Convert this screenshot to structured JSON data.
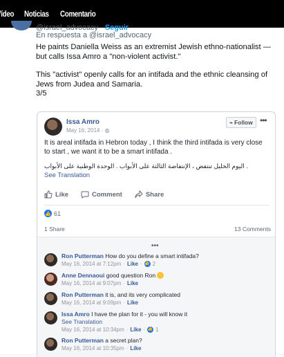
{
  "nav": {
    "items": [
      "Vídeo",
      "Noticias",
      "Comentario"
    ]
  },
  "tweet": {
    "handle_cut": "@israel_advocacy",
    "follow_cut": "Seguir",
    "reply_to": "En respuesta a @israel_advocacy",
    "paragraph1": "He paints Daniella Weiss as an extremist Jewish ethno-nationalist — but calls Issa Amro a \"non-violent activist.\"",
    "paragraph2": "This \"activist\" openly calls for an intifada and the ethnic cleansing of Jews from Judea and Samaria.",
    "counter": "3/5"
  },
  "fb": {
    "author": "Issa Amro",
    "date": "May 16, 2014 · ",
    "follow_label": "Follow",
    "more": "•••",
    "post_text": "It is areal intifada in Hebron today , I think the third intifada is very close to start , we want it to be a smart intifada .",
    "arabic_text": "اليوم الخليل تنتفض ، الإنتفاضة الثالثة على الأبواب . الوحدة الوطنية على الأبواب .",
    "see_translation": "See Translation",
    "actions": {
      "like": "Like",
      "comment": "Comment",
      "share": "Share"
    },
    "likes_count": "61",
    "shares": "1 Share",
    "comments_count": "13 Comments",
    "more_comments": "•••",
    "comments": [
      {
        "name": "Ron Putterman",
        "text": " How do you define a smart intifada?",
        "time": "May 16, 2014 at 7:12pm",
        "like": "Like",
        "likes": "2"
      },
      {
        "name": "Anne Dennaoui",
        "text": " good question Ron ",
        "time": "May 16, 2014 at 9:07pm",
        "like": "Like"
      },
      {
        "name": "Ron Putterman",
        "text": " it is, and its very complicated",
        "time": "May 16, 2014 at 9:09pm",
        "like": "Like"
      },
      {
        "name": "Issa Amro",
        "text": " I have the plan for it - you will know it",
        "see_translation": "See Translation",
        "time": "May 16, 2014 at 10:34pm",
        "like": "Like",
        "likes": "1"
      },
      {
        "name": "Ron Putterman",
        "text": " a secret plan?",
        "time": "May 16, 2014 at 10:35pm",
        "like": "Like"
      }
    ]
  },
  "colors": {
    "fb_blue": "#365899",
    "like_blue": "#1877f2",
    "muted": "#90949c"
  }
}
